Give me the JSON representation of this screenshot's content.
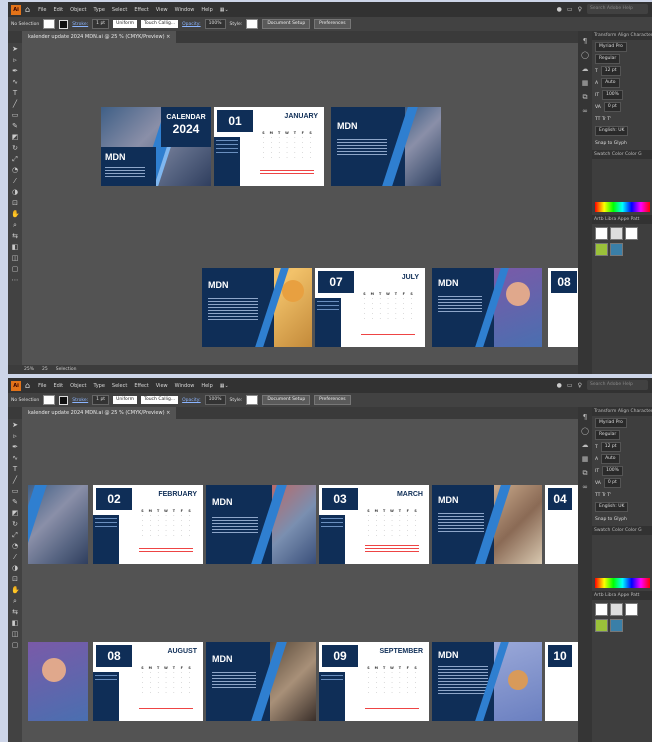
{
  "app": {
    "logo": "Ai",
    "menu": [
      "File",
      "Edit",
      "Object",
      "Type",
      "Select",
      "Effect",
      "View",
      "Window",
      "Help"
    ],
    "search_placeholder": "Search Adobe Help"
  },
  "control_bar": {
    "selection": "No Selection",
    "stroke_label": "Stroke:",
    "stroke_value": "1 pt",
    "uniform": "Uniform",
    "brush": "Touch Callig...",
    "opacity_label": "Opacity:",
    "opacity_value": "100%",
    "style_label": "Style:",
    "doc_setup": "Document Setup",
    "preferences": "Preferences"
  },
  "document": {
    "tab_title": "kalender update 2024 MDN.ai @ 25 % (CMYK/Preview)",
    "tab_close": "×"
  },
  "status": {
    "zoom": "25%",
    "artboard": "25",
    "mode": "Selection"
  },
  "panel": {
    "tabs": "Transform  Align  Character",
    "font_family": "Myriad Pro",
    "font_style": "Regular",
    "size": "12 pt",
    "leading": "Auto",
    "scale_v": "100%",
    "tracking": "0 pt",
    "tt": "TT  Tr  T'",
    "lang": "English: UK",
    "snap": "Snap to Glyph",
    "color_tabs": "Swatch  Color  Color G",
    "asset_tabs": "Artb  Libra  Appe  Patt"
  },
  "top": {
    "cover": {
      "title1": "CALENDAR",
      "title2": "2024",
      "brand": "MDN"
    },
    "jan": {
      "num": "01",
      "name": "JANUARY"
    },
    "mdn_a": "MDN",
    "jul": {
      "num": "07",
      "name": "JULY"
    },
    "mdn_b": "MDN",
    "mdn_c": "MDN",
    "partial": "08"
  },
  "bottom": {
    "feb": {
      "num": "02",
      "name": "FEBRUARY"
    },
    "mdn_a": "MDN",
    "mar": {
      "num": "03",
      "name": "MARCH"
    },
    "mdn_b": "MDN",
    "partial1": "04",
    "aug": {
      "num": "08",
      "name": "AUGUST"
    },
    "mdn_c": "MDN",
    "sep": {
      "num": "09",
      "name": "SEPTEMBER"
    },
    "mdn_d": "MDN",
    "partial2": "10"
  },
  "weekdays": [
    "S",
    "M",
    "T",
    "W",
    "T",
    "F",
    "S"
  ],
  "colors": {
    "navy": "#0f2e57",
    "accent": "#2f7fd0",
    "ui_dark": "#323232",
    "canvas": "#535353"
  }
}
